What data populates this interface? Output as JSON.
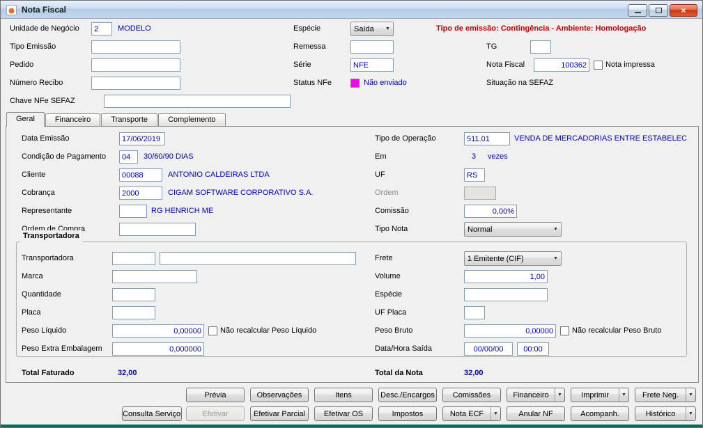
{
  "window": {
    "title": "Nota Fiscal"
  },
  "icons": {
    "close": "×",
    "dropdown": "▼"
  },
  "header": {
    "unidade": {
      "label": "Unidade de Negócio",
      "value": "2",
      "desc": "MODELO"
    },
    "especie": {
      "label": "Espécie",
      "value": "Saída"
    },
    "banner": "Tipo de emissão: Contingência - Ambiente: Homologação",
    "tipo_emissao": {
      "label": "Tipo Emissão",
      "value": ""
    },
    "remessa": {
      "label": "Remessa",
      "value": ""
    },
    "tg": {
      "label": "TG",
      "value": ""
    },
    "pedido": {
      "label": "Pedido",
      "value": ""
    },
    "serie": {
      "label": "Série",
      "value": "NFE"
    },
    "nota_fiscal": {
      "label": "Nota Fiscal",
      "value": "100362"
    },
    "nota_impressa": {
      "label": "Nota impressa",
      "checked": false
    },
    "numero_recibo": {
      "label": "Número Recibo",
      "value": ""
    },
    "status_nfe": {
      "label": "Status NFe",
      "value": "Não enviado",
      "color": "#FF00FF"
    },
    "situacao": {
      "label": "Situação na SEFAZ"
    },
    "chave": {
      "label": "Chave NFe SEFAZ",
      "value": ""
    }
  },
  "tabs": [
    {
      "label": "Geral",
      "active": true
    },
    {
      "label": "Financeiro",
      "active": false
    },
    {
      "label": "Transporte",
      "active": false
    },
    {
      "label": "Complemento",
      "active": false
    }
  ],
  "geral": {
    "data_emissao": {
      "label": "Data Emissão",
      "value": "17/06/2019"
    },
    "condicao_pagamento": {
      "label": "Condição de Pagamento",
      "value": "04",
      "desc": "30/60/90 DIAS"
    },
    "cliente": {
      "label": "Cliente",
      "value": "00088",
      "desc": "ANTONIO CALDEIRAS LTDA"
    },
    "cobranca": {
      "label": "Cobrança",
      "value": "2000",
      "desc": "CIGAM SOFTWARE CORPORATIVO S.A."
    },
    "representante": {
      "label": "Representante",
      "value": "",
      "desc": "RG HENRICH ME"
    },
    "ordem_compra": {
      "label": "Ordem de Compra",
      "value": ""
    },
    "tipo_operacao": {
      "label": "Tipo de Operação",
      "value": "511.01",
      "desc": "VENDA DE MERCADORIAS ENTRE ESTABELECIMEN"
    },
    "em": {
      "label": "Em",
      "value": "3",
      "suffix": "vezes"
    },
    "uf": {
      "label": "UF",
      "value": "RS"
    },
    "ordem": {
      "label": "Ordem",
      "value": "",
      "disabled": true
    },
    "comissao": {
      "label": "Comissão",
      "value": "0,00%"
    },
    "tipo_nota": {
      "label": "Tipo Nota",
      "value": "Normal"
    }
  },
  "transportadora": {
    "title": "Transportadora",
    "transportadora": {
      "label": "Transportadora",
      "code": "",
      "name": ""
    },
    "marca": {
      "label": "Marca",
      "value": ""
    },
    "quantidade": {
      "label": "Quantidade",
      "value": ""
    },
    "placa": {
      "label": "Placa",
      "value": ""
    },
    "peso_liquido": {
      "label": "Peso Líquido",
      "value": "0,00000",
      "check_label": "Não recalcular Peso Líquido",
      "checked": false
    },
    "peso_extra": {
      "label": "Peso Extra Embalagem",
      "value": "0,000000"
    },
    "frete": {
      "label": "Frete",
      "value": "1 Emitente (CIF)"
    },
    "volume": {
      "label": "Volume",
      "value": "1,00"
    },
    "especie": {
      "label": "Espécie",
      "value": ""
    },
    "uf_placa": {
      "label": "UF Placa",
      "value": ""
    },
    "peso_bruto": {
      "label": "Peso Bruto",
      "value": "0,00000",
      "check_label": "Não recalcular Peso Bruto",
      "checked": false
    },
    "data_hora_saida": {
      "label": "Data/Hora Saída",
      "date": "00/00/00",
      "time": "00:00"
    }
  },
  "totals": {
    "faturado_label": "Total Faturado",
    "faturado_value": "32,00",
    "nota_label": "Total da Nota",
    "nota_value": "32,00"
  },
  "buttons": {
    "row1": [
      {
        "label": "Prévia"
      },
      {
        "label": "Observações"
      },
      {
        "label": "Itens"
      },
      {
        "label": "Desc./Encargos"
      },
      {
        "label": "Comissões"
      },
      {
        "label": "Financeiro",
        "split": true
      },
      {
        "label": "Imprimir",
        "split": true
      },
      {
        "label": "Frete Neg.",
        "split": true
      }
    ],
    "row2": [
      {
        "label": "Consulta Serviços"
      },
      {
        "label": "Efetivar",
        "disabled": true
      },
      {
        "label": "Efetivar Parcial"
      },
      {
        "label": "Efetivar OS"
      },
      {
        "label": "Impostos"
      },
      {
        "label": "Nota ECF",
        "split": true
      },
      {
        "label": "Anular NF"
      },
      {
        "label": "Acompanh."
      },
      {
        "label": "Histórico",
        "split": true
      }
    ]
  }
}
